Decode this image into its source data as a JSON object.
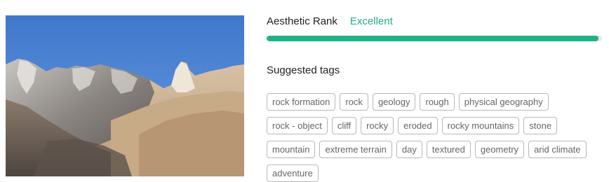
{
  "image": {
    "alt": "Rocky desert mountains under a blue sky"
  },
  "aesthetic": {
    "label": "Aesthetic Rank",
    "value": "Excellent",
    "score": 0.99
  },
  "tags_section": {
    "title": "Suggested tags",
    "tags": [
      "rock formation",
      "rock",
      "geology",
      "rough",
      "physical geography",
      "rock - object",
      "cliff",
      "rocky",
      "eroded",
      "rocky mountains",
      "stone",
      "mountain",
      "extreme terrain",
      "day",
      "textured",
      "geometry",
      "arid climate",
      "adventure"
    ]
  },
  "colors": {
    "accent_text": "#22b07d",
    "bar_fill": "#1db386",
    "bar_track": "#e6e6e6",
    "tag_border": "#b8b8b8",
    "tag_text": "#666666"
  }
}
